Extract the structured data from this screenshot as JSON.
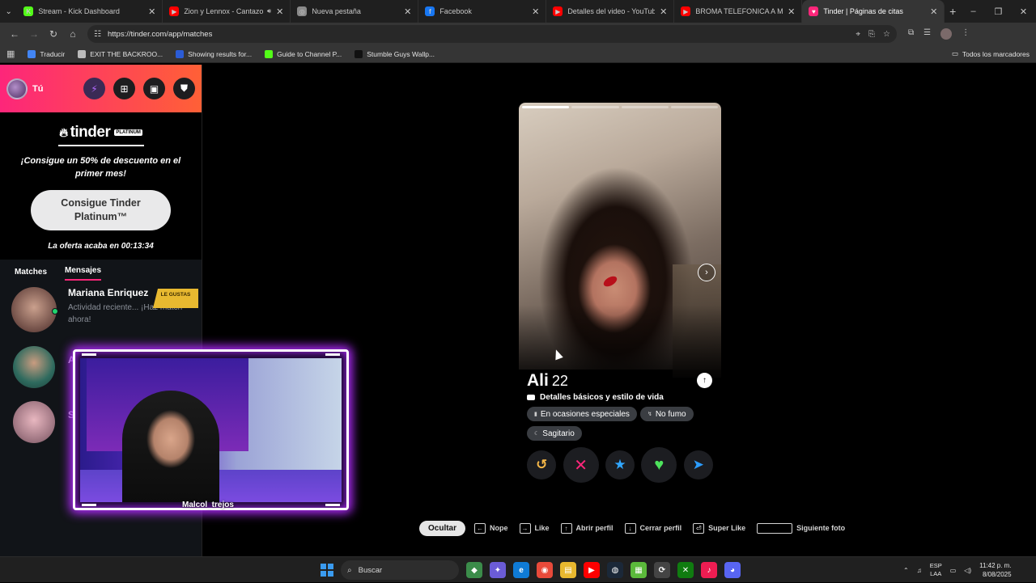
{
  "browser": {
    "tabs": [
      {
        "title": "Stream - Kick Dashboard",
        "fav_color": "#53fc18",
        "fav_glyph": "K",
        "active": false
      },
      {
        "title": "Zion y Lennox - Cantazo ft.",
        "fav_color": "#ff0000",
        "fav_glyph": "▶",
        "active": false,
        "audio": true
      },
      {
        "title": "Nueva pestaña",
        "fav_color": "#8a8a8a",
        "fav_glyph": "◎",
        "active": false
      },
      {
        "title": "Facebook",
        "fav_color": "#1877f2",
        "fav_glyph": "f",
        "active": false
      },
      {
        "title": "Detalles del video - YouTube St",
        "fav_color": "#ff0000",
        "fav_glyph": "▶",
        "active": false
      },
      {
        "title": "BROMA TELEFONICA A MAMÁ",
        "fav_color": "#ff0000",
        "fav_glyph": "▶",
        "active": false
      },
      {
        "title": "Tinder | Páginas de citas",
        "fav_color": "#fd267a",
        "fav_glyph": "♥",
        "active": true
      }
    ],
    "url": "https://tinder.com/app/matches",
    "bookmarks": [
      {
        "label": "Traducir",
        "color": "#4285f4"
      },
      {
        "label": "EXIT THE BACKROO...",
        "color": "#bbbbbb"
      },
      {
        "label": "Showing results for...",
        "color": "#2b5cd6"
      },
      {
        "label": "Guide to Channel P...",
        "color": "#53fc18"
      },
      {
        "label": "Stumble Guys Wallp...",
        "color": "#111111"
      }
    ],
    "all_bookmarks": "Todos los marcadores"
  },
  "sidebar": {
    "you_label": "Tú",
    "promo": {
      "logo": "tinder",
      "tier": "PLATINUM",
      "headline": "¡Consigue un 50% de descuento en el primer mes!",
      "cta": "Consigue Tinder Platinum™",
      "timer": "La oferta acaba en 00:13:34"
    },
    "tabs": [
      "Matches",
      "Mensajes"
    ],
    "active_tab": "Mensajes",
    "messages": [
      {
        "name": "Mariana Enriquez",
        "preview": "Actividad reciente... ¡Haz match ahora!",
        "badge": "LE GUSTAS"
      }
    ],
    "peek_letters": [
      "A",
      "S"
    ]
  },
  "card": {
    "name": "Ali",
    "age": "22",
    "section": "Detalles básicos y estilo de vida",
    "chips": [
      {
        "icon": "glass-icon",
        "label": "En ocasiones especiales"
      },
      {
        "icon": "smoke-icon",
        "label": "No fumo"
      },
      {
        "icon": "zodiac-icon",
        "label": "Sagitario"
      }
    ],
    "actions": [
      "rewind",
      "nope",
      "super-like",
      "like",
      "boost"
    ]
  },
  "hints": {
    "hide": "Ocultar",
    "items": [
      {
        "key": "←",
        "label": "Nope"
      },
      {
        "key": "→",
        "label": "Like"
      },
      {
        "key": "↑",
        "label": "Abrir perfil"
      },
      {
        "key": "↓",
        "label": "Cerrar perfil"
      },
      {
        "key": "⏎",
        "label": "Super Like"
      },
      {
        "key": "",
        "label": "Siguiente foto",
        "wide": true
      }
    ]
  },
  "overlay": {
    "streamer_name": "Malcol_trejos"
  },
  "taskbar": {
    "search_placeholder": "Buscar",
    "apps": [
      {
        "color": "#3b8c4a",
        "glyph": "◆"
      },
      {
        "color": "#6b5cd6",
        "glyph": "✦"
      },
      {
        "color": "#0f7bd6",
        "glyph": "e"
      },
      {
        "color": "#e84a3a",
        "glyph": "◉"
      },
      {
        "color": "#e8b82f",
        "glyph": "▤"
      },
      {
        "color": "#ff0000",
        "glyph": "▶"
      },
      {
        "color": "#1b2838",
        "glyph": "◍"
      },
      {
        "color": "#5bba3b",
        "glyph": "▦"
      },
      {
        "color": "#444444",
        "glyph": "⟳"
      },
      {
        "color": "#107c10",
        "glyph": "✕"
      },
      {
        "color": "#ee1d52",
        "glyph": "♪"
      },
      {
        "color": "#5865f2",
        "glyph": "◕"
      }
    ],
    "lang_top": "ESP",
    "lang_bottom": "LAA",
    "time": "11:42 p. m.",
    "date": "8/08/2025"
  }
}
